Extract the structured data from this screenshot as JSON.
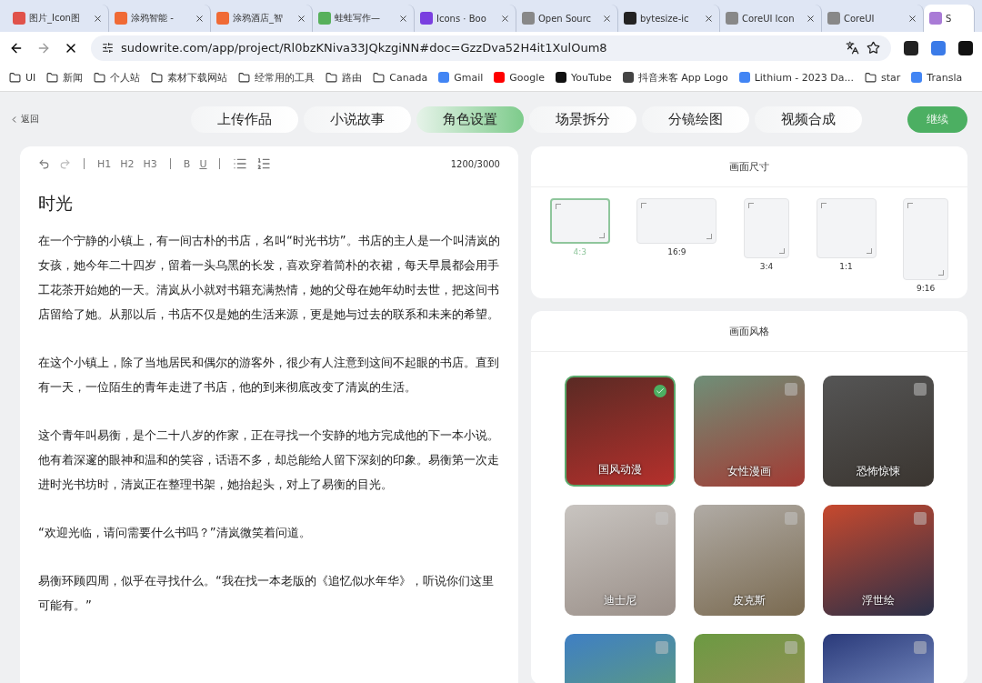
{
  "browser": {
    "tabs": [
      {
        "title": "图片_Icon图",
        "selected": false
      },
      {
        "title": "涂鸦智能 - ",
        "selected": false
      },
      {
        "title": "涂鸦酒店_智",
        "selected": false
      },
      {
        "title": "蛙蛙写作—",
        "selected": false
      },
      {
        "title": "Icons · Boo",
        "selected": false
      },
      {
        "title": "Open Sourc",
        "selected": false
      },
      {
        "title": "bytesize-ic",
        "selected": false
      },
      {
        "title": "CoreUI Icon",
        "selected": false
      },
      {
        "title": "CoreUI",
        "selected": false
      },
      {
        "title": "S",
        "selected": true
      }
    ],
    "address": "sudowrite.com/app/project/Rl0bzKNiva33JQkzgiNN#doc=GzzDva52H4it1XulOum8",
    "bookmarks": [
      {
        "label": "UI",
        "kind": "folder"
      },
      {
        "label": "新闻",
        "kind": "folder"
      },
      {
        "label": "个人站",
        "kind": "folder"
      },
      {
        "label": "素材下载网站",
        "kind": "folder"
      },
      {
        "label": "经常用的工具",
        "kind": "folder"
      },
      {
        "label": "路由",
        "kind": "folder"
      },
      {
        "label": "Canada",
        "kind": "folder"
      },
      {
        "label": "Gmail",
        "kind": "site"
      },
      {
        "label": "Google",
        "kind": "site"
      },
      {
        "label": "YouTube",
        "kind": "site"
      },
      {
        "label": "抖音来客 App Logo",
        "kind": "site"
      },
      {
        "label": "Lithium - 2023 Da...",
        "kind": "site"
      },
      {
        "label": "star",
        "kind": "folder"
      },
      {
        "label": "Transla",
        "kind": "site"
      }
    ]
  },
  "page": {
    "back_link": "返回",
    "steps": [
      {
        "label": "上传作品",
        "selected": false
      },
      {
        "label": "小说故事",
        "selected": false
      },
      {
        "label": "角色设置",
        "selected": true
      },
      {
        "label": "场景拆分",
        "selected": false
      },
      {
        "label": "分镜绘图",
        "selected": false
      },
      {
        "label": "视频合成",
        "selected": false
      }
    ],
    "continue_button": "继续"
  },
  "editor": {
    "headings": [
      "H1",
      "H2",
      "H3"
    ],
    "bold": "B",
    "underline": "U",
    "counter": "1200/3000",
    "title": "时光",
    "paragraphs": [
      "在一个宁静的小镇上，有一间古朴的书店，名叫“时光书坊”。书店的主人是一个叫清岚的女孩，她今年二十四岁，留着一头乌黑的长发，喜欢穿着简朴的衣裙，每天早晨都会用手工花茶开始她的一天。清岚从小就对书籍充满热情，她的父母在她年幼时去世，把这间书店留给了她。从那以后，书店不仅是她的生活来源，更是她与过去的联系和未来的希望。",
      "在这个小镇上，除了当地居民和偶尔的游客外，很少有人注意到这间不起眼的书店。直到有一天，一位陌生的青年走进了书店，他的到来彻底改变了清岚的生活。",
      "这个青年叫易衡，是个二十八岁的作家，正在寻找一个安静的地方完成他的下一本小说。他有着深邃的眼神和温和的笑容，话语不多，却总能给人留下深刻的印象。易衡第一次走进时光书坊时，清岚正在整理书架，她抬起头，对上了易衡的目光。",
      "“欢迎光临，请问需要什么书吗？”清岚微笑着问道。",
      "易衡环顾四周，似乎在寻找什么。“我在找一本老版的《追忆似水年华》，听说你们这里可能有。”"
    ]
  },
  "size_panel": {
    "title": "画面尺寸",
    "options": [
      {
        "label": "4:3",
        "kind": "landscape",
        "selected": true
      },
      {
        "label": "16:9",
        "kind": "wide",
        "selected": false
      },
      {
        "label": "3:4",
        "kind": "portrait",
        "selected": false
      },
      {
        "label": "1:1",
        "kind": "square",
        "selected": false
      },
      {
        "label": "9:16",
        "kind": "tall",
        "selected": false
      }
    ]
  },
  "style_panel": {
    "title": "画面风格",
    "styles": [
      {
        "label": "国风动漫",
        "selected": true
      },
      {
        "label": "女性漫画",
        "selected": false
      },
      {
        "label": "恐怖惊悚",
        "selected": false
      },
      {
        "label": "迪士尼",
        "selected": false
      },
      {
        "label": "皮克斯",
        "selected": false
      },
      {
        "label": "浮世绘",
        "selected": false
      },
      {
        "selected": false
      },
      {
        "selected": false
      },
      {
        "selected": false
      }
    ]
  }
}
